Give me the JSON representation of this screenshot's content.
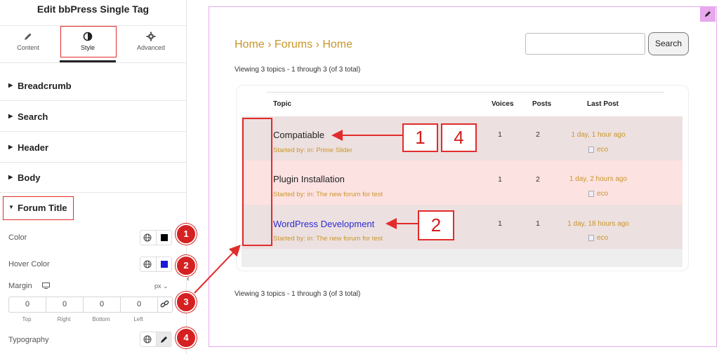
{
  "panel": {
    "title": "Edit bbPress Single Tag",
    "tabs": [
      {
        "label": "Content",
        "icon": "pencil-icon"
      },
      {
        "label": "Style",
        "icon": "half-circle-icon"
      },
      {
        "label": "Advanced",
        "icon": "gear-icon"
      }
    ],
    "sections": [
      "Breadcrumb",
      "Search",
      "Header",
      "Body",
      "Forum Title"
    ],
    "controls": {
      "color_label": "Color",
      "color_value": "#000000",
      "hover_color_label": "Hover Color",
      "hover_color_value": "#1a1ad8",
      "margin_label": "Margin",
      "margin_unit": "px",
      "margin_values": [
        "0",
        "0",
        "0",
        "0"
      ],
      "margin_captions": [
        "Top",
        "Right",
        "Bottom",
        "Left"
      ],
      "typography_label": "Typography"
    },
    "badges": [
      "1",
      "2",
      "3",
      "4"
    ]
  },
  "preview": {
    "breadcrumb": "Home › Forums › Home",
    "search_button": "Search",
    "viewing_top": "Viewing 3 topics - 1 through 3 (of 3 total)",
    "viewing_bottom": "Viewing 3 topics - 1 through 3 (of 3 total)",
    "headers": {
      "topic": "Topic",
      "voices": "Voices",
      "posts": "Posts",
      "last_post": "Last Post"
    },
    "rows": [
      {
        "title": "Compatiable",
        "started": "Started by: in: Prime Slider",
        "voices": "1",
        "posts": "2",
        "last_post": "1 day, 1 hour ago",
        "author": "eco"
      },
      {
        "title": "Plugin Installation",
        "started": "Started by: in: The new forum for test",
        "voices": "1",
        "posts": "2",
        "last_post": "1 day, 2 hours ago",
        "author": "eco"
      },
      {
        "title": "WordPress Development",
        "started": "Started by: in: The new forum for test",
        "voices": "1",
        "posts": "1",
        "last_post": "1 day, 18 hours ago",
        "author": "eco"
      }
    ],
    "callouts": [
      "1",
      "4",
      "2"
    ]
  },
  "colors": {
    "accent_red": "#e22b2b",
    "link_gold": "#c8962a",
    "hover_blue": "#2b2bd0",
    "frame_pink": "#e7a8ee"
  }
}
